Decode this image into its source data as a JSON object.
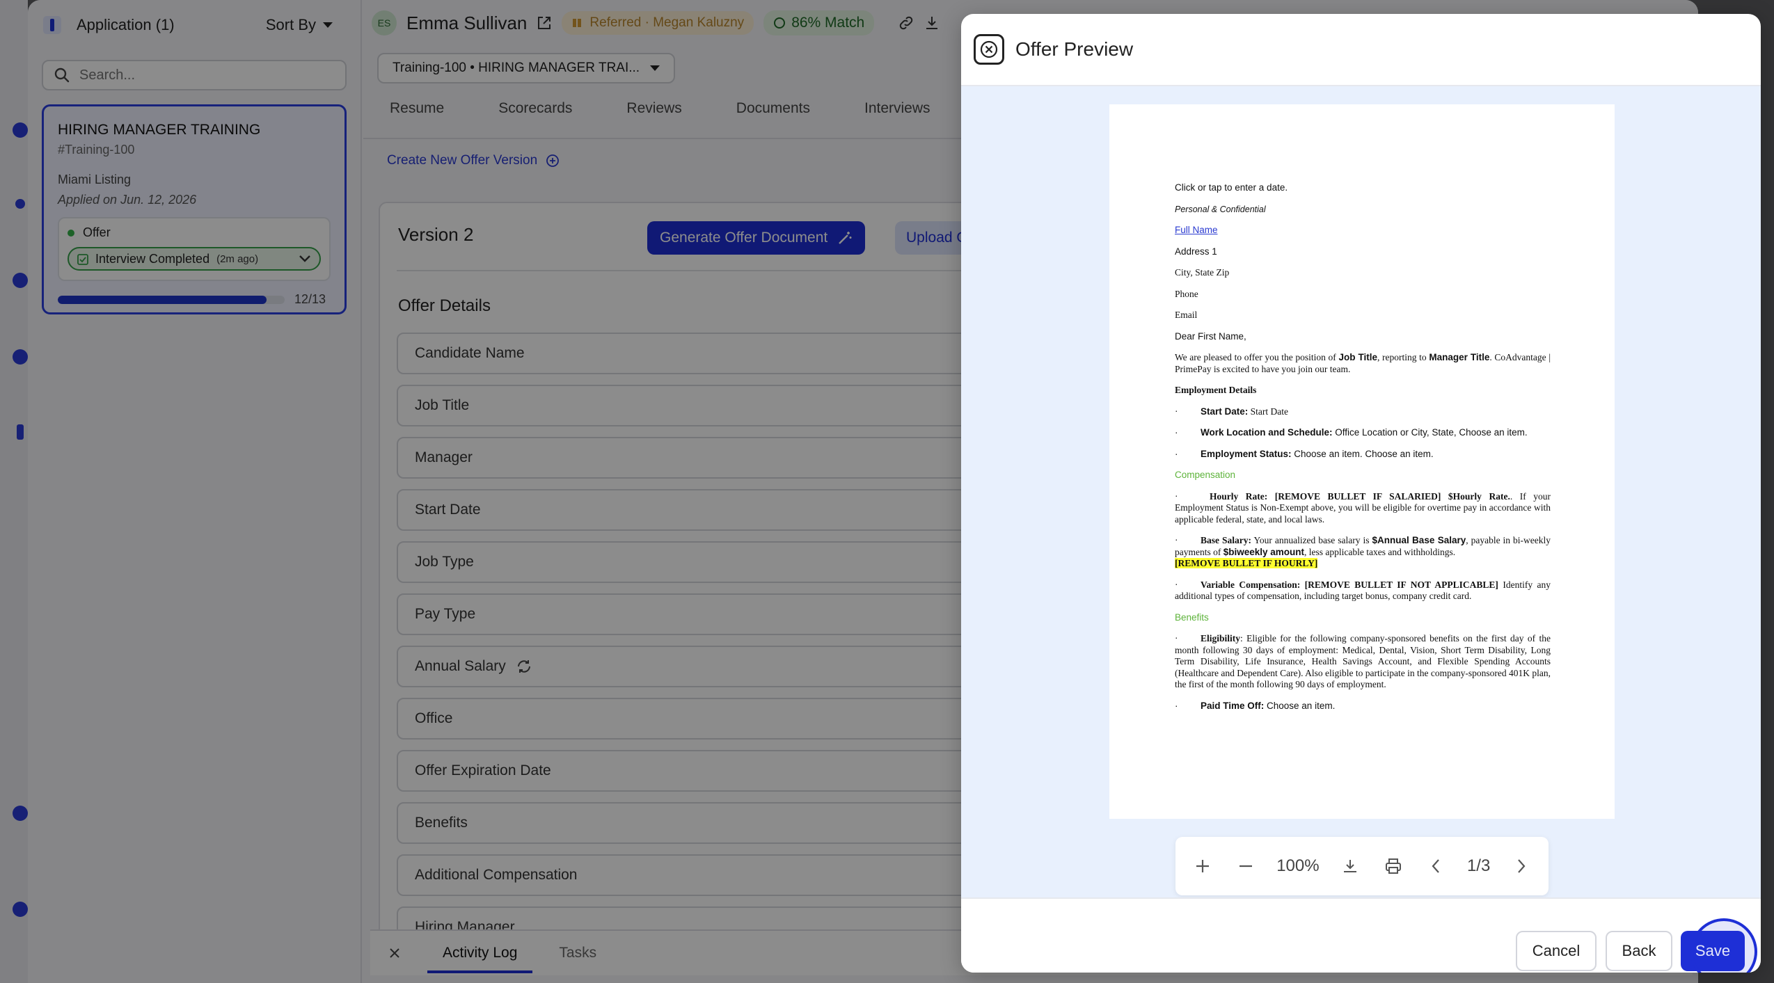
{
  "sidebar_col": {
    "title": "Application (1)",
    "sort_label": "Sort By",
    "search_placeholder": "Search...",
    "card": {
      "title": "HIRING MANAGER TRAINING",
      "id": "#Training-100",
      "location": "Miami Listing",
      "applied": "Applied on Jun. 12, 2026",
      "stage": "Offer",
      "status": "Interview Completed",
      "status_ago": "(2m ago)",
      "progress_text": "12/13",
      "progress_value": 0.92
    }
  },
  "candidate": {
    "initials": "ES",
    "name": "Emma Sullivan",
    "referred": "Referred · Megan Kaluzny",
    "match": "86% Match",
    "requisition": "Training-100 • HIRING MANAGER TRAI..."
  },
  "tabs": [
    "Resume",
    "Scorecards",
    "Reviews",
    "Documents",
    "Interviews"
  ],
  "offer": {
    "create_link": "Create New Offer Version",
    "version_title": "Version 2",
    "generate_btn": "Generate Offer Document",
    "upload_btn": "Upload Offer D",
    "details_title": "Offer Details",
    "fields": [
      "Candidate Name",
      "Job Title",
      "Manager",
      "Start Date",
      "Job Type",
      "Pay Type",
      "Annual Salary",
      "Office",
      "Offer Expiration Date",
      "Benefits",
      "Additional Compensation",
      "Hiring Manager"
    ]
  },
  "bottom_bar": {
    "tab_active": "Activity Log",
    "tab_other": "Tasks"
  },
  "modal": {
    "title": "Offer Preview",
    "zoom": "100%",
    "page": "1/3",
    "cancel": "Cancel",
    "back": "Back",
    "save": "Save"
  },
  "document": {
    "date_line": "Click or tap to enter a date.",
    "confidential": "Personal & Confidential",
    "full_name": "Full Name",
    "address": "Address 1",
    "city": "City, State Zip",
    "phone": "Phone",
    "email": "Email",
    "greeting": "Dear First Name,",
    "intro_a": "We are pleased to offer you the position of ",
    "intro_job": "Job Title",
    "intro_b": ", reporting to ",
    "intro_mgr": "Manager Title",
    "intro_c": ". CoAdvantage | PrimePay is excited to have you join our team.",
    "emp_details": "Employment Details",
    "start_label": "Start Date:",
    "start_val": " Start Date",
    "work_label": "Work Location and Schedule:",
    "work_val": " Office Location or City, State, Choose an item.",
    "status_label": "Employment Status:",
    "status_val": " Choose an item. Choose an item.",
    "compensation": "Compensation",
    "hourly_label": "Hourly Rate: [REMOVE BULLET IF SALARIED] $Hourly Rate.",
    "hourly_val": ". If your Employment Status is Non-Exempt above, you will be eligible for overtime pay in accordance with applicable federal, state, and local laws.",
    "base_label": "Base Salary:",
    "base_a": " Your annualized base salary is ",
    "base_amt": "$Annual Base Salary",
    "base_b": ", payable in bi-weekly payments of ",
    "base_biw": "$biweekly amount",
    "base_c": ", less applicable taxes and withholdings.",
    "remove_hourly": "[REMOVE BULLET IF HOURLY]",
    "var_label": "Variable Compensation: [REMOVE BULLET IF NOT APPLICABLE]",
    "var_val": " Identify any additional types of compensation, including target bonus, company credit card.",
    "benefits": "Benefits",
    "elig_label": "Eligibility",
    "elig_val": ": Eligible for the following company-sponsored benefits on the first day of the month following 30 days of employment: Medical, Dental, Vision, Short Term Disability, Long Term Disability, Life Insurance, Health Savings Account, and Flexible Spending Accounts (Healthcare and Dependent Care). Also eligible to participate in the company-sponsored 401K plan, the first of the month following 90 days of employment.",
    "pto_label": "Paid Time Off:",
    "pto_val": " Choose an item.",
    "bullet": "·"
  }
}
